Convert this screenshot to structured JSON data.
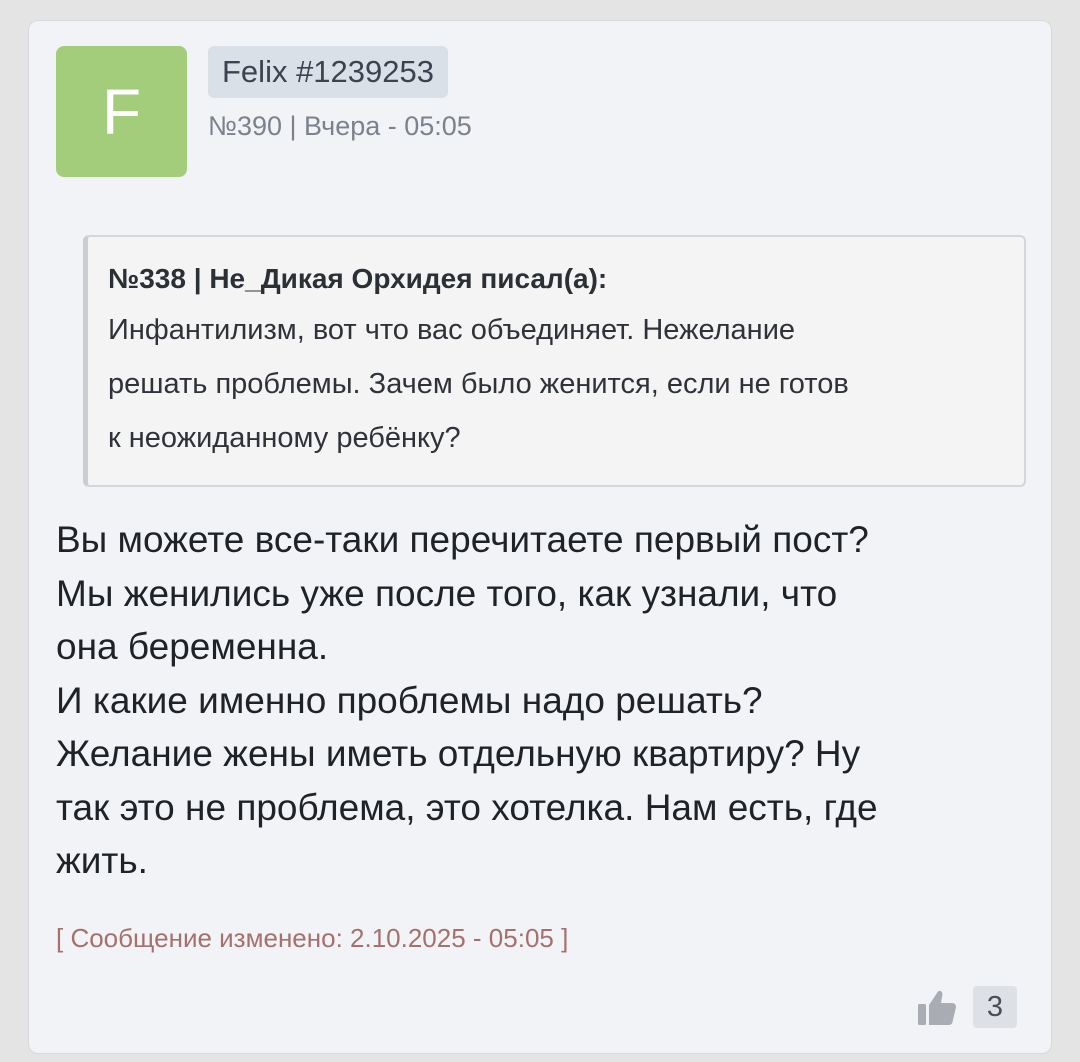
{
  "post": {
    "avatar_letter": "F",
    "avatar_color": "#a3cd7a",
    "username": "Felix #1239253",
    "meta": "№390 | Вчера - 05:05",
    "quote": {
      "header": "№338 | Не_Дикая Орхидея писал(а):",
      "lines": [
        "Инфантилизм, вот что вас объединяет. Нежелание",
        "решать проблемы. Зачем было женится, если не готов",
        "к неожиданному ребёнку?"
      ]
    },
    "message_lines": [
      "Вы можете все-таки перечитаете первый пост?",
      "Мы женились уже после того, как узнали, что",
      "она беременна.",
      "И какие именно проблемы надо решать?",
      "Желание жены иметь отдельную квартиру? Ну",
      "так это не проблема, это хотелка. Нам есть, где",
      "жить."
    ],
    "edited_note": "[ Сообщение изменено: 2.10.2025 - 05:05 ]",
    "like_icon": "thumbs-up-icon",
    "like_count": "3"
  }
}
